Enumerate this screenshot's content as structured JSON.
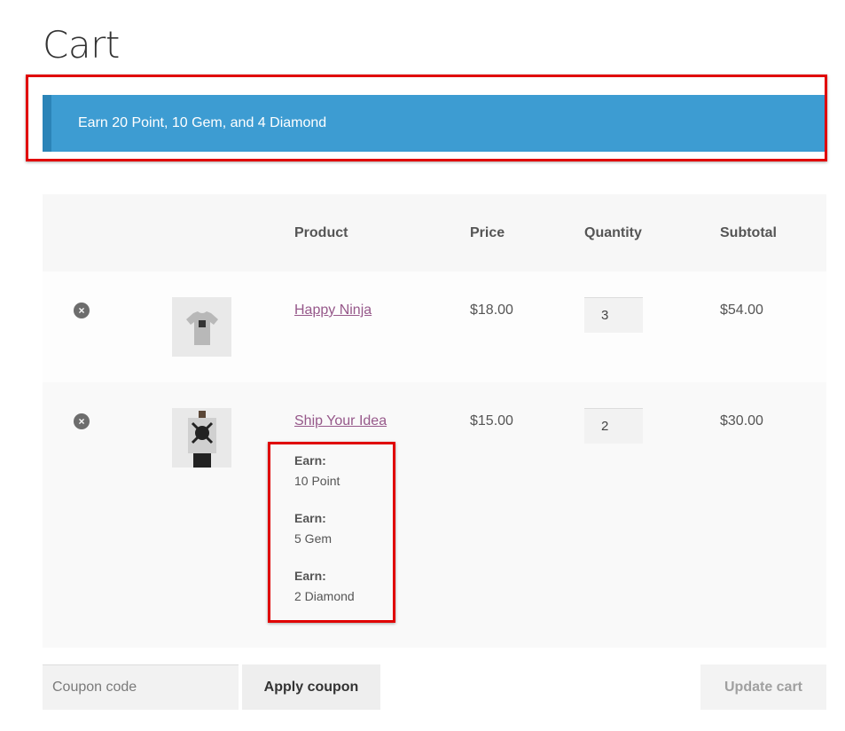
{
  "page": {
    "title": "Cart"
  },
  "notice": {
    "text": "Earn 20 Point, 10 Gem, and 4 Diamond",
    "background": "#3d9cd2"
  },
  "table": {
    "headers": {
      "product": "Product",
      "price": "Price",
      "quantity": "Quantity",
      "subtotal": "Subtotal"
    },
    "rows": [
      {
        "remove_icon": "×",
        "thumbnail": "tshirt-icon",
        "product": "Happy Ninja",
        "price": "$18.00",
        "quantity": "3",
        "subtotal": "$54.00"
      },
      {
        "remove_icon": "×",
        "thumbnail": "poster-icon",
        "product": "Ship Your Idea",
        "price": "$15.00",
        "quantity": "2",
        "subtotal": "$30.00",
        "earn": [
          {
            "label": "Earn:",
            "value": "10 Point"
          },
          {
            "label": "Earn:",
            "value": "5 Gem"
          },
          {
            "label": "Earn:",
            "value": "2 Diamond"
          }
        ]
      }
    ]
  },
  "coupon": {
    "placeholder": "Coupon code",
    "apply_label": "Apply coupon"
  },
  "actions": {
    "update_label": "Update cart"
  },
  "colors": {
    "link": "#96588a",
    "highlight": "#e00000"
  }
}
